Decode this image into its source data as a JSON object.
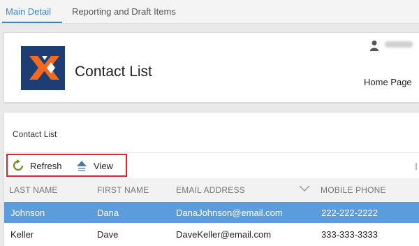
{
  "tabs": [
    {
      "label": "Main Detail",
      "active": true
    },
    {
      "label": "Reporting and Draft Items",
      "active": false
    }
  ],
  "header": {
    "title": "Contact List",
    "home_link": "Home Page",
    "logo_colors": {
      "background": "#1d3d73",
      "mark_left": "#f06a1f",
      "mark_right": "#ffffff"
    },
    "user_icon": "user-icon"
  },
  "list": {
    "title": "Contact List",
    "toolbar": {
      "refresh_label": "Refresh",
      "refresh_icon": "refresh-icon",
      "view_label": "View",
      "view_icon": "up-arrow-icon",
      "highlight_color": "#e0252a"
    },
    "columns": [
      "LAST NAME",
      "FIRST NAME",
      "EMAIL ADDRESS",
      "MOBILE PHONE"
    ],
    "rows": [
      {
        "last": "Johnson",
        "first": "Dana",
        "email": "DanaJohnson@email.com",
        "phone": "222-222-2222",
        "selected": true
      },
      {
        "last": "Keller",
        "first": "Dave",
        "email": "DaveKeller@email.com",
        "phone": "333-333-3333",
        "selected": false
      }
    ],
    "selected_row_color": "#5b9ddc"
  },
  "accent_color": "#3a87c7"
}
